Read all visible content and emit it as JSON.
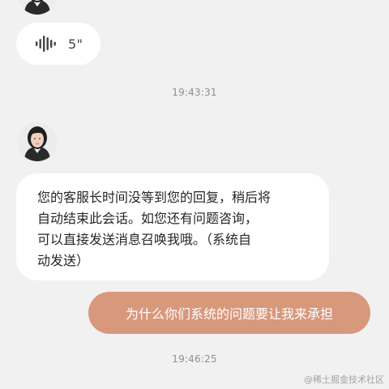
{
  "voice_message": {
    "duration": "5\"",
    "icon": "voice-wave-icon"
  },
  "timestamps": [
    "19:43:31",
    "19:46:25"
  ],
  "agent_message": {
    "lines": [
      "您的客服长时间没等到您的回复，稍后将",
      "自动结束此会话。如您还有问题咨询，",
      "可以直接发送消息召唤我哦。（系统自",
      "动发送）"
    ]
  },
  "user_message": {
    "text": "为什么你们系统的问题要让我来承担"
  },
  "watermark": "@稀土掘金技术社区",
  "colors": {
    "background": "#f1f1f1",
    "incoming_bubble": "#ffffff",
    "outgoing_bubble": "#d8987c",
    "timestamp_text": "#8f8f8f"
  }
}
